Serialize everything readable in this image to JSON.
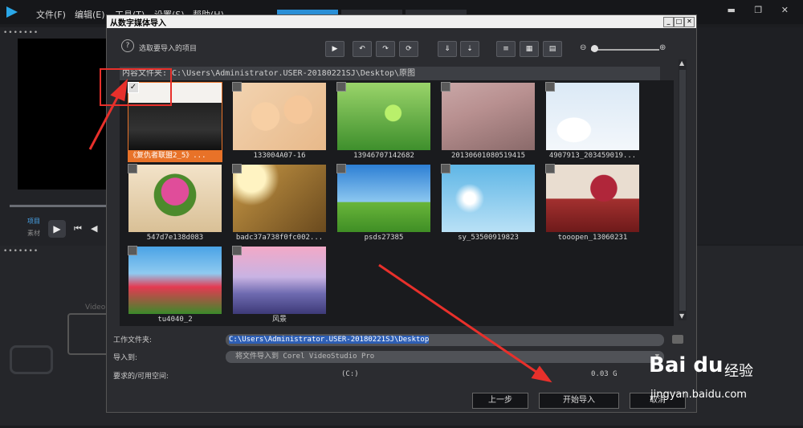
{
  "menubar": {
    "items": [
      "文件(F)",
      "编辑(E)",
      "工具(T)",
      "设置(S)",
      "帮助(H)"
    ]
  },
  "left_pane": {
    "project_label": "项目",
    "clip_label": "素材",
    "video_label": "Video"
  },
  "dialog": {
    "title": "从数字媒体导入",
    "hint": "选取要导入的项目",
    "folder_path": "内容文件夹: C:\\Users\\Administrator.USER-20180221SJ\\Desktop\\原图",
    "thumbnails": [
      {
        "caption": "《复仇者联盟2_5》...",
        "selected": true
      },
      {
        "caption": "133004A07-16",
        "selected": false
      },
      {
        "caption": "13946707142682",
        "selected": false
      },
      {
        "caption": "20130601080519415",
        "selected": false
      },
      {
        "caption": "4907913_203459019...",
        "selected": false
      },
      {
        "caption": "547d7e138d083",
        "selected": false
      },
      {
        "caption": "badc37a738f0fc002...",
        "selected": false
      },
      {
        "caption": "psds27385",
        "selected": false
      },
      {
        "caption": "sy_53500919823",
        "selected": false
      },
      {
        "caption": "tooopen_13060231",
        "selected": false
      },
      {
        "caption": "tu4040_2",
        "selected": false
      },
      {
        "caption": "风景",
        "selected": false
      }
    ],
    "work_folder_label": "工作文件夹:",
    "work_folder_value": "C:\\Users\\Administrator.USER-20180221SJ\\Desktop",
    "import_to_label": "导入到:",
    "import_to_value": "将文件导入到 Corel VideoStudio Pro",
    "space_label": "要求的/可用空间:",
    "space_drive": "(C:)",
    "space_size": "0.03 G",
    "buttons": {
      "prev": "上一步",
      "start": "开始导入",
      "cancel": "取消"
    }
  },
  "watermark": {
    "brand": "Bai du",
    "cn": "经验",
    "url": "jingyan.baidu.com"
  }
}
